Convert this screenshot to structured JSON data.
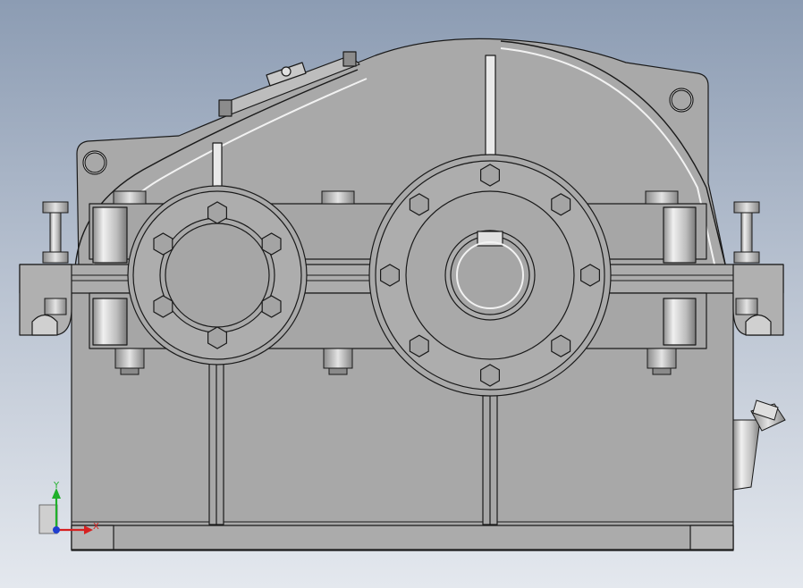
{
  "viewport": {
    "model": "gear-reducer-housing",
    "view": "front",
    "colors": {
      "bg_top": "#8c9cb3",
      "bg_bottom": "#e4e8ee",
      "body": "#a8a8a8",
      "edge": "#1a1a1a",
      "highlight": "#f2f2f2"
    }
  },
  "triad": {
    "x_label": "X",
    "y_label": "Y",
    "x_color": "#d62020",
    "y_color": "#1fb02a",
    "z_color": "#1f3fd0"
  }
}
